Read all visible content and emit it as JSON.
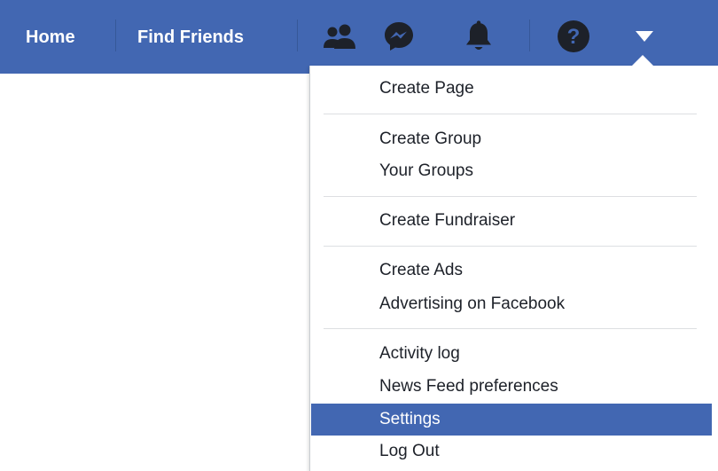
{
  "topbar": {
    "background_color": "#4267b2",
    "home_label": "Home",
    "find_friends_label": "Find Friends",
    "icons": [
      "friend-requests-icon",
      "messenger-icon",
      "notifications-bell-icon",
      "help-question-icon",
      "account-menu-caret-icon"
    ]
  },
  "menu": {
    "items": [
      {
        "label": "Create Page"
      },
      {
        "label": "Create Group"
      },
      {
        "label": "Your Groups"
      },
      {
        "label": "Create Fundraiser"
      },
      {
        "label": "Create Ads"
      },
      {
        "label": "Advertising on Facebook"
      },
      {
        "label": "Activity log"
      },
      {
        "label": "News Feed preferences"
      },
      {
        "label": "Settings",
        "highlighted": true
      },
      {
        "label": "Log Out"
      }
    ],
    "highlight_color": "#4267b2"
  }
}
